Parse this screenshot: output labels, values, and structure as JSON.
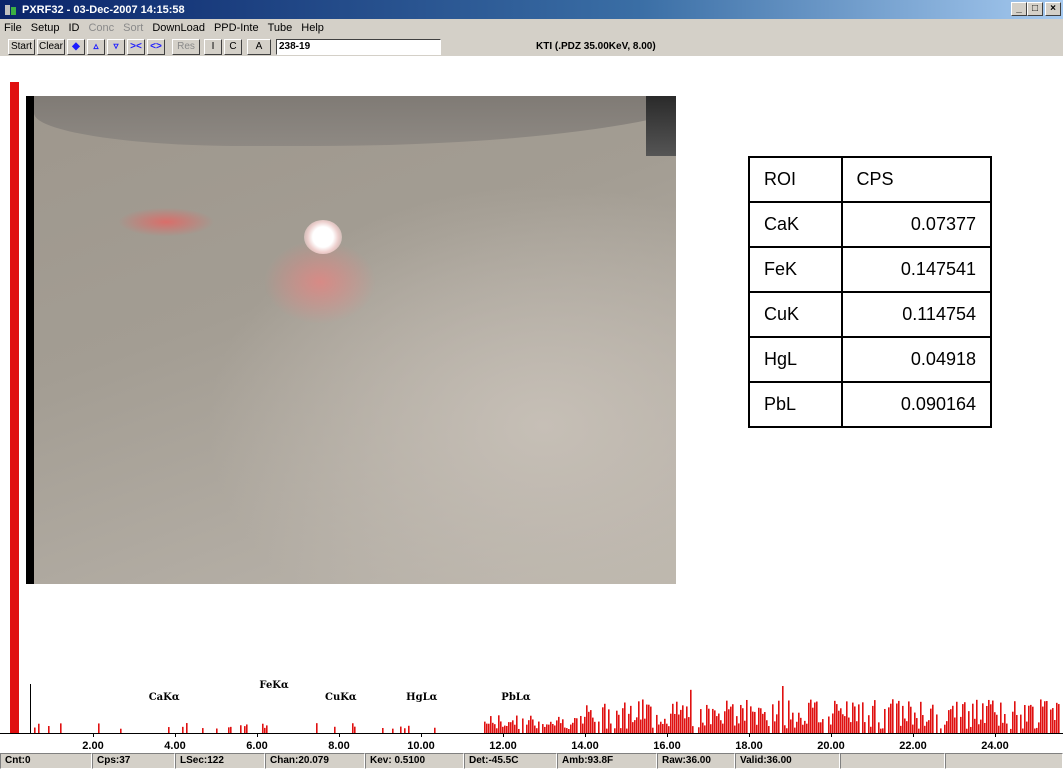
{
  "window": {
    "title": "PXRF32 - 03-Dec-2007 14:15:58",
    "min_label": "_",
    "max_label": "□",
    "close_label": "×"
  },
  "menu": {
    "items": [
      {
        "label": "File",
        "enabled": true
      },
      {
        "label": "Setup",
        "enabled": true
      },
      {
        "label": "ID",
        "enabled": true
      },
      {
        "label": "Conc",
        "enabled": false
      },
      {
        "label": "Sort",
        "enabled": false
      },
      {
        "label": "DownLoad",
        "enabled": true
      },
      {
        "label": "PPD-Inte",
        "enabled": true
      },
      {
        "label": "Tube",
        "enabled": true
      },
      {
        "label": "Help",
        "enabled": true
      }
    ]
  },
  "toolbar": {
    "start": "Start",
    "clear": "Clear",
    "res": "Res",
    "i": "I",
    "c": "C",
    "a": "A",
    "sample_id": "238-19",
    "source_info": "KTI  (.PDZ 35.00KeV, 8.00)"
  },
  "roi_table": {
    "header": {
      "roi": "ROI",
      "cps": "CPS"
    },
    "rows": [
      {
        "roi": "CaK",
        "cps": "0.07377"
      },
      {
        "roi": "FeK",
        "cps": "0.147541"
      },
      {
        "roi": "CuK",
        "cps": "0.114754"
      },
      {
        "roi": "HgL",
        "cps": "0.04918"
      },
      {
        "roi": "PbL",
        "cps": "0.090164"
      }
    ]
  },
  "spectrum": {
    "peak_labels": [
      {
        "text": "CaKα",
        "kev": 3.7
      },
      {
        "text": "FeKα",
        "kev": 6.4
      },
      {
        "text": "CuKα",
        "kev": 8.0
      },
      {
        "text": "HgLα",
        "kev": 9.98
      },
      {
        "text": "PbLα",
        "kev": 12.3
      }
    ],
    "tick_labels": [
      "2.00",
      "4.00",
      "6.00",
      "8.00",
      "10.00",
      "12.00",
      "14.00",
      "16.00",
      "18.00",
      "20.00",
      "22.00",
      "24.00"
    ],
    "color": "#e01010"
  },
  "status": {
    "cnt": "Cnt:0",
    "cps": "Cps:37",
    "lsec": "LSec:122",
    "chan": "Chan:20.079",
    "kev": "Kev: 0.5100",
    "det": "Det:-45.5C",
    "amb": "Amb:93.8F",
    "raw": "Raw:36.00",
    "valid": "Valid:36.00"
  }
}
